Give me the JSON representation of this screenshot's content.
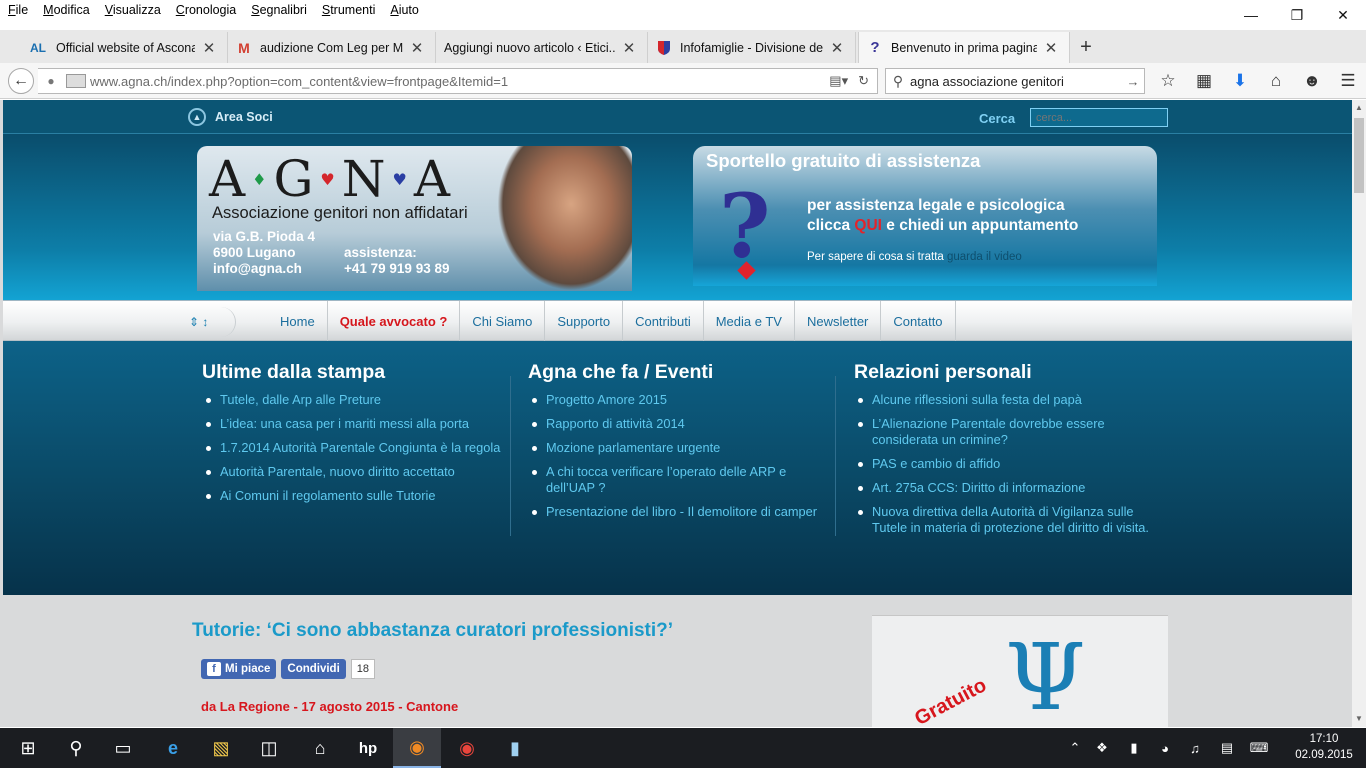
{
  "menu": [
    "File",
    "Modifica",
    "Visualizza",
    "Cronologia",
    "Segnalibri",
    "Strumenti",
    "Aiuto"
  ],
  "menu_underline": [
    "F",
    "M",
    "V",
    "C",
    "S",
    "S",
    "A"
  ],
  "tabs": [
    {
      "icon": "AL",
      "label": "Official website of Ascona..."
    },
    {
      "icon": "M",
      "label": "audizione Com Leg per M..."
    },
    {
      "icon": "",
      "label": "Aggiungi nuovo articolo ‹ Etici..."
    },
    {
      "icon": "shield",
      "label": "Infofamiglie - Divisione de..."
    },
    {
      "icon": "?",
      "label": "Benvenuto in prima pagina"
    }
  ],
  "url": "www.agna.ch/index.php?option=com_content&view=frontpage&Itemid=1",
  "search": {
    "value": "agna associazione genitori"
  },
  "site": {
    "area_soci": "Area Soci",
    "cerca_label": "Cerca",
    "cerca_placeholder": "cerca...",
    "logo": {
      "letters": [
        "A",
        "G",
        "N",
        "A"
      ],
      "subtitle": "Associazione genitori non affidatari",
      "address": [
        "via G.B. Pioda 4",
        "6900 Lugano",
        "info@agna.ch"
      ],
      "assist_label": "assistenza:",
      "assist_phone": "+41 79 919 93 89"
    },
    "sportello": {
      "title": "Sportello gratuito di assistenza",
      "line1": "per assistenza legale e psicologica",
      "line2_pre": "clicca",
      "line2_qui": "QUI",
      "line2_post": "e chiedi un appuntamento",
      "line3_pre": "Per sapere di cosa si tratta",
      "line3_link": "guarda il video"
    },
    "nav": [
      "Home",
      "Quale avvocato ?",
      "Chi Siamo",
      "Supporto",
      "Contributi",
      "Media e TV",
      "Newsletter",
      "Contatto"
    ],
    "columns": [
      {
        "title": "Ultime dalla stampa",
        "items": [
          "Tutele, dalle Arp alle Preture",
          "L’idea: una casa per i mariti messi alla porta",
          "1.7.2014 Autorità Parentale Congiunta è la regola",
          "Autorità Parentale, nuovo diritto accettato",
          "Ai Comuni il regolamento sulle Tutorie"
        ]
      },
      {
        "title": "Agna che fa / Eventi",
        "items": [
          "Progetto Amore 2015",
          "Rapporto di attività 2014",
          "Mozione parlamentare urgente",
          "A chi tocca verificare l’operato delle ARP e dell’UAP ?",
          "Presentazione del libro - Il demolitore di camper"
        ]
      },
      {
        "title": "Relazioni personali",
        "items": [
          "Alcune riflessioni sulla festa del papà",
          "L’Alienazione Parentale dovrebbe essere considerata un crimine?",
          "PAS e cambio di affido",
          "Art. 275a CCS: Diritto di informazione",
          "Nuova direttiva della Autorità di Vigilanza sulle Tutele in materia di protezione del diritto di visita."
        ]
      }
    ],
    "article": {
      "title": "Tutorie: ‘Ci sono abbastanza curatori professionisti?’",
      "like": "Mi piace",
      "share": "Condividi",
      "count": "18",
      "source": "da La Regione - 17 agosto 2015 - Cantone"
    },
    "side_image_text": "Gratuito"
  },
  "taskbar": {
    "time": "17:10",
    "date": "02.09.2015"
  },
  "colors": {
    "accent": "#1b9ac9",
    "nav_red": "#d5161c",
    "dark_band": "#0a4966"
  }
}
